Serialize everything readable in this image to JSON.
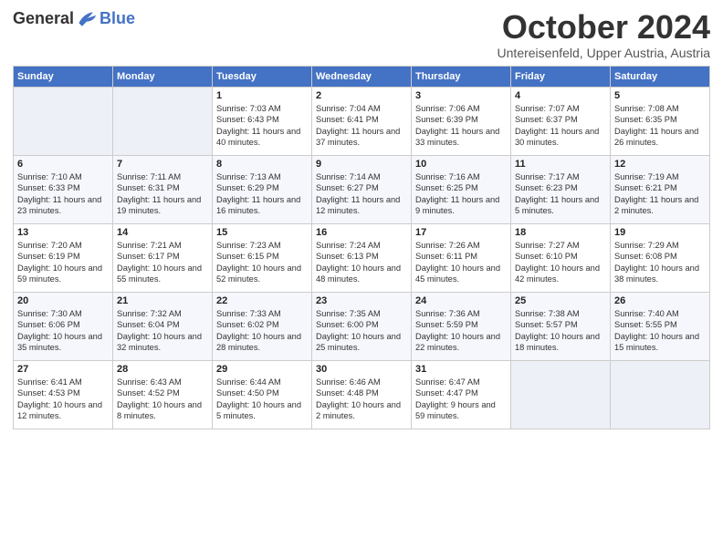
{
  "header": {
    "logo_general": "General",
    "logo_blue": "Blue",
    "month_title": "October 2024",
    "subtitle": "Untereisenfeld, Upper Austria, Austria"
  },
  "weekdays": [
    "Sunday",
    "Monday",
    "Tuesday",
    "Wednesday",
    "Thursday",
    "Friday",
    "Saturday"
  ],
  "weeks": [
    [
      {
        "day": "",
        "sunrise": "",
        "sunset": "",
        "daylight": ""
      },
      {
        "day": "",
        "sunrise": "",
        "sunset": "",
        "daylight": ""
      },
      {
        "day": "1",
        "sunrise": "Sunrise: 7:03 AM",
        "sunset": "Sunset: 6:43 PM",
        "daylight": "Daylight: 11 hours and 40 minutes."
      },
      {
        "day": "2",
        "sunrise": "Sunrise: 7:04 AM",
        "sunset": "Sunset: 6:41 PM",
        "daylight": "Daylight: 11 hours and 37 minutes."
      },
      {
        "day": "3",
        "sunrise": "Sunrise: 7:06 AM",
        "sunset": "Sunset: 6:39 PM",
        "daylight": "Daylight: 11 hours and 33 minutes."
      },
      {
        "day": "4",
        "sunrise": "Sunrise: 7:07 AM",
        "sunset": "Sunset: 6:37 PM",
        "daylight": "Daylight: 11 hours and 30 minutes."
      },
      {
        "day": "5",
        "sunrise": "Sunrise: 7:08 AM",
        "sunset": "Sunset: 6:35 PM",
        "daylight": "Daylight: 11 hours and 26 minutes."
      }
    ],
    [
      {
        "day": "6",
        "sunrise": "Sunrise: 7:10 AM",
        "sunset": "Sunset: 6:33 PM",
        "daylight": "Daylight: 11 hours and 23 minutes."
      },
      {
        "day": "7",
        "sunrise": "Sunrise: 7:11 AM",
        "sunset": "Sunset: 6:31 PM",
        "daylight": "Daylight: 11 hours and 19 minutes."
      },
      {
        "day": "8",
        "sunrise": "Sunrise: 7:13 AM",
        "sunset": "Sunset: 6:29 PM",
        "daylight": "Daylight: 11 hours and 16 minutes."
      },
      {
        "day": "9",
        "sunrise": "Sunrise: 7:14 AM",
        "sunset": "Sunset: 6:27 PM",
        "daylight": "Daylight: 11 hours and 12 minutes."
      },
      {
        "day": "10",
        "sunrise": "Sunrise: 7:16 AM",
        "sunset": "Sunset: 6:25 PM",
        "daylight": "Daylight: 11 hours and 9 minutes."
      },
      {
        "day": "11",
        "sunrise": "Sunrise: 7:17 AM",
        "sunset": "Sunset: 6:23 PM",
        "daylight": "Daylight: 11 hours and 5 minutes."
      },
      {
        "day": "12",
        "sunrise": "Sunrise: 7:19 AM",
        "sunset": "Sunset: 6:21 PM",
        "daylight": "Daylight: 11 hours and 2 minutes."
      }
    ],
    [
      {
        "day": "13",
        "sunrise": "Sunrise: 7:20 AM",
        "sunset": "Sunset: 6:19 PM",
        "daylight": "Daylight: 10 hours and 59 minutes."
      },
      {
        "day": "14",
        "sunrise": "Sunrise: 7:21 AM",
        "sunset": "Sunset: 6:17 PM",
        "daylight": "Daylight: 10 hours and 55 minutes."
      },
      {
        "day": "15",
        "sunrise": "Sunrise: 7:23 AM",
        "sunset": "Sunset: 6:15 PM",
        "daylight": "Daylight: 10 hours and 52 minutes."
      },
      {
        "day": "16",
        "sunrise": "Sunrise: 7:24 AM",
        "sunset": "Sunset: 6:13 PM",
        "daylight": "Daylight: 10 hours and 48 minutes."
      },
      {
        "day": "17",
        "sunrise": "Sunrise: 7:26 AM",
        "sunset": "Sunset: 6:11 PM",
        "daylight": "Daylight: 10 hours and 45 minutes."
      },
      {
        "day": "18",
        "sunrise": "Sunrise: 7:27 AM",
        "sunset": "Sunset: 6:10 PM",
        "daylight": "Daylight: 10 hours and 42 minutes."
      },
      {
        "day": "19",
        "sunrise": "Sunrise: 7:29 AM",
        "sunset": "Sunset: 6:08 PM",
        "daylight": "Daylight: 10 hours and 38 minutes."
      }
    ],
    [
      {
        "day": "20",
        "sunrise": "Sunrise: 7:30 AM",
        "sunset": "Sunset: 6:06 PM",
        "daylight": "Daylight: 10 hours and 35 minutes."
      },
      {
        "day": "21",
        "sunrise": "Sunrise: 7:32 AM",
        "sunset": "Sunset: 6:04 PM",
        "daylight": "Daylight: 10 hours and 32 minutes."
      },
      {
        "day": "22",
        "sunrise": "Sunrise: 7:33 AM",
        "sunset": "Sunset: 6:02 PM",
        "daylight": "Daylight: 10 hours and 28 minutes."
      },
      {
        "day": "23",
        "sunrise": "Sunrise: 7:35 AM",
        "sunset": "Sunset: 6:00 PM",
        "daylight": "Daylight: 10 hours and 25 minutes."
      },
      {
        "day": "24",
        "sunrise": "Sunrise: 7:36 AM",
        "sunset": "Sunset: 5:59 PM",
        "daylight": "Daylight: 10 hours and 22 minutes."
      },
      {
        "day": "25",
        "sunrise": "Sunrise: 7:38 AM",
        "sunset": "Sunset: 5:57 PM",
        "daylight": "Daylight: 10 hours and 18 minutes."
      },
      {
        "day": "26",
        "sunrise": "Sunrise: 7:40 AM",
        "sunset": "Sunset: 5:55 PM",
        "daylight": "Daylight: 10 hours and 15 minutes."
      }
    ],
    [
      {
        "day": "27",
        "sunrise": "Sunrise: 6:41 AM",
        "sunset": "Sunset: 4:53 PM",
        "daylight": "Daylight: 10 hours and 12 minutes."
      },
      {
        "day": "28",
        "sunrise": "Sunrise: 6:43 AM",
        "sunset": "Sunset: 4:52 PM",
        "daylight": "Daylight: 10 hours and 8 minutes."
      },
      {
        "day": "29",
        "sunrise": "Sunrise: 6:44 AM",
        "sunset": "Sunset: 4:50 PM",
        "daylight": "Daylight: 10 hours and 5 minutes."
      },
      {
        "day": "30",
        "sunrise": "Sunrise: 6:46 AM",
        "sunset": "Sunset: 4:48 PM",
        "daylight": "Daylight: 10 hours and 2 minutes."
      },
      {
        "day": "31",
        "sunrise": "Sunrise: 6:47 AM",
        "sunset": "Sunset: 4:47 PM",
        "daylight": "Daylight: 9 hours and 59 minutes."
      },
      {
        "day": "",
        "sunrise": "",
        "sunset": "",
        "daylight": ""
      },
      {
        "day": "",
        "sunrise": "",
        "sunset": "",
        "daylight": ""
      }
    ]
  ]
}
